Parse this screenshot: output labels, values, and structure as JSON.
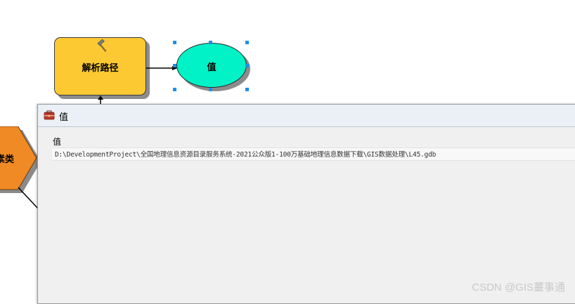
{
  "model": {
    "tool": {
      "label": "解析路径",
      "icon": "hammer-icon",
      "fill": "#fdc933"
    },
    "value_node": {
      "label": "值",
      "fill": "#00f2c6"
    },
    "feature_node": {
      "label": "素类",
      "fill": "#f08a24"
    },
    "selection_color": "#1f8fe8"
  },
  "dialog": {
    "title": "值",
    "icon": "toolbox-icon",
    "field_label": "值",
    "path_value": "D:\\DevelopmentProject\\全国地理信息资源目录服务系统-2021公众版1-100万基础地理信息数据下载\\GIS数据处理\\L45.gdb"
  },
  "watermark": "CSDN @GIS薑事通"
}
